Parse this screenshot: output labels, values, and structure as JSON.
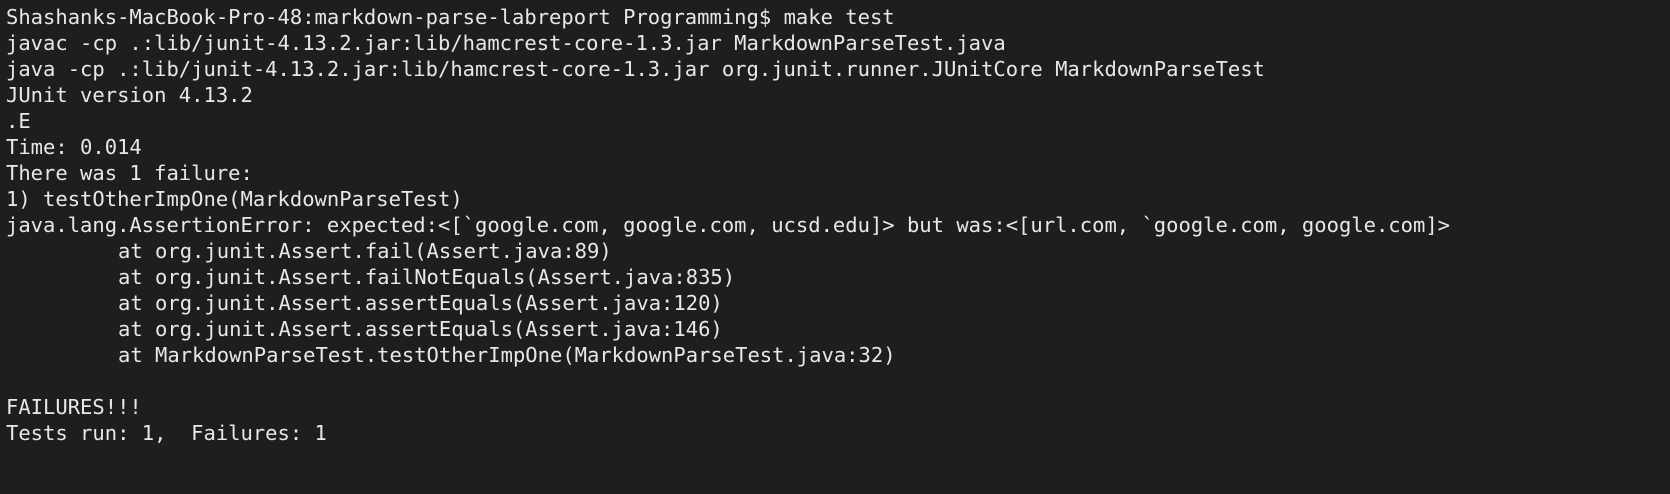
{
  "terminal": {
    "partial_top_line": "",
    "prompt": {
      "host": "Shashanks-MacBook-Pro-48:markdown-parse-labreport Programming$",
      "command": "make test"
    },
    "lines": [
      "javac -cp .:lib/junit-4.13.2.jar:lib/hamcrest-core-1.3.jar MarkdownParseTest.java",
      "java -cp .:lib/junit-4.13.2.jar:lib/hamcrest-core-1.3.jar org.junit.runner.JUnitCore MarkdownParseTest",
      "JUnit version 4.13.2",
      ".E",
      "Time: 0.014",
      "There was 1 failure:",
      "1) testOtherImpOne(MarkdownParseTest)",
      "java.lang.AssertionError: expected:<[`google.com, google.com, ucsd.edu]> but was:<[url.com, `google.com, google.com]>"
    ],
    "stack_trace": [
      "at org.junit.Assert.fail(Assert.java:89)",
      "at org.junit.Assert.failNotEquals(Assert.java:835)",
      "at org.junit.Assert.assertEquals(Assert.java:120)",
      "at org.junit.Assert.assertEquals(Assert.java:146)",
      "at MarkdownParseTest.testOtherImpOne(MarkdownParseTest.java:32)"
    ],
    "summary": [
      "FAILURES!!!",
      "Tests run: 1,  Failures: 1"
    ]
  }
}
